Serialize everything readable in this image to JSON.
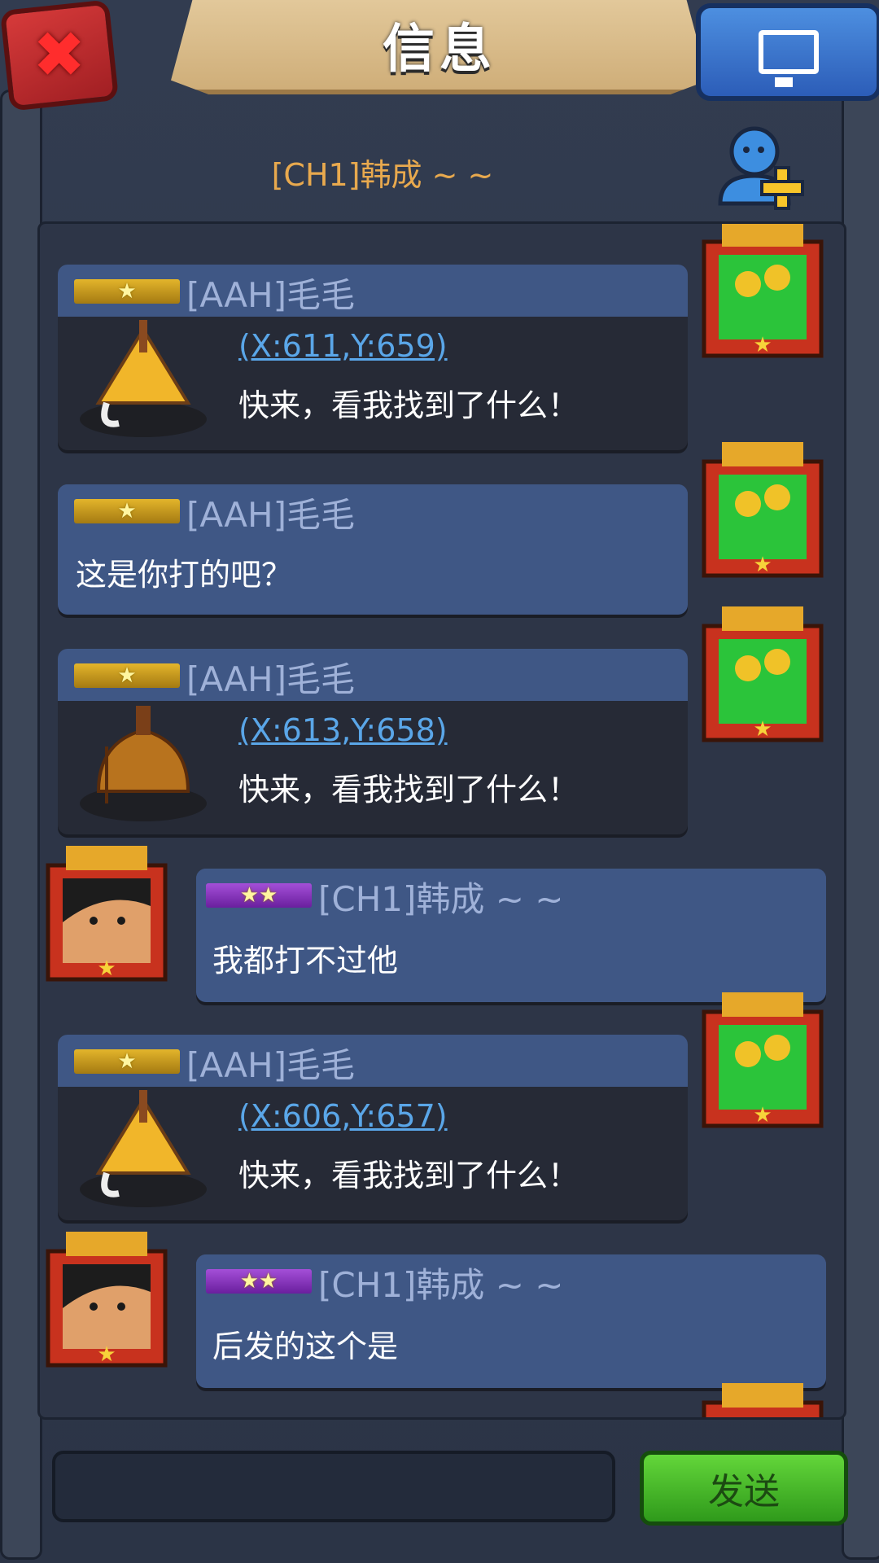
{
  "header": {
    "title": "信息",
    "close_icon": "close-x-icon",
    "screen_icon": "monitor-icon"
  },
  "chat": {
    "partner_name": "[CH1]韩成 ~ ~",
    "add_friend_icon": "add-friend-icon"
  },
  "messages": [
    {
      "sender": "[AAH]毛毛",
      "coord": "(X:611,Y:659)",
      "text": "快来，看我找到了什么！",
      "stars": "★"
    },
    {
      "sender": "[AAH]毛毛",
      "text": "这是你打的吧？",
      "stars": "★"
    },
    {
      "sender": "[AAH]毛毛",
      "coord": "(X:613,Y:658)",
      "text": "快来，看我找到了什么！",
      "stars": "★"
    },
    {
      "sender": "[CH1]韩成 ~ ~",
      "text": "我都打不过他",
      "stars": "★★"
    },
    {
      "sender": "[AAH]毛毛",
      "coord": "(X:606,Y:657)",
      "text": "快来，看我找到了什么！",
      "stars": "★"
    },
    {
      "sender": "[CH1]韩成 ~ ~",
      "text": "后发的这个是",
      "stars": "★★"
    }
  ],
  "input": {
    "placeholder": ""
  },
  "send_label": "发送",
  "colors": {
    "accent_gold": "#e8a94e",
    "link_blue": "#5aa6e8",
    "send_green": "#3fb523"
  }
}
